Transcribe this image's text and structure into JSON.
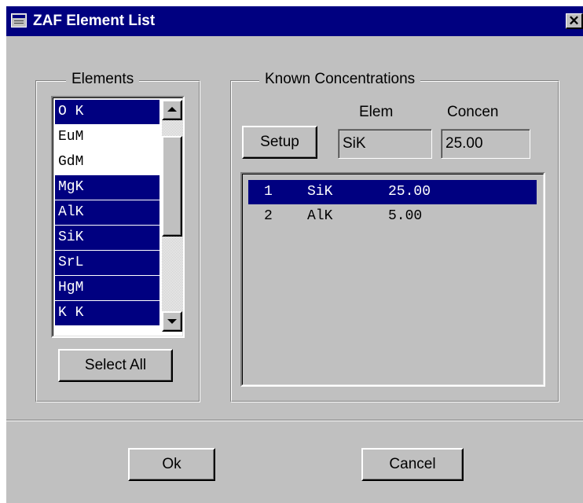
{
  "window": {
    "title": "ZAF Element List",
    "close_glyph": "✕"
  },
  "elements_group": {
    "legend": "Elements",
    "items": [
      {
        "label": "O K",
        "selected": true
      },
      {
        "label": "EuM",
        "selected": false
      },
      {
        "label": "GdM",
        "selected": false
      },
      {
        "label": "MgK",
        "selected": true
      },
      {
        "label": "AlK",
        "selected": true
      },
      {
        "label": "SiK",
        "selected": true
      },
      {
        "label": "SrL",
        "selected": true
      },
      {
        "label": "HgM",
        "selected": true
      },
      {
        "label": "K K",
        "selected": true
      }
    ],
    "select_all_label": "Select All"
  },
  "known_group": {
    "legend": "Known Concentrations",
    "elem_label": "Elem",
    "concen_label": "Concen",
    "setup_label": "Setup",
    "elem_value": "SiK",
    "concen_value": "25.00",
    "rows": [
      {
        "num": "1",
        "elem": "SiK",
        "conc": "25.00",
        "selected": true
      },
      {
        "num": "2",
        "elem": "AlK",
        "conc": "5.00",
        "selected": false
      }
    ]
  },
  "footer": {
    "ok_label": "Ok",
    "cancel_label": "Cancel"
  },
  "colors": {
    "selection": "#000080",
    "face": "#c0c0c0",
    "titlebar": "#000080"
  }
}
